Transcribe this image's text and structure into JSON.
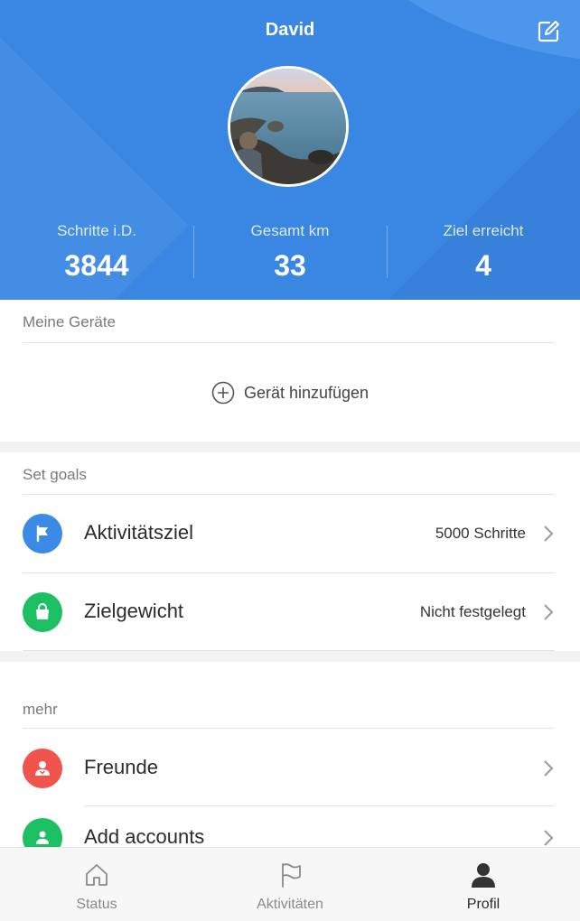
{
  "header": {
    "user_name": "David",
    "stats": [
      {
        "label": "Schritte i.D.",
        "value": "3844"
      },
      {
        "label": "Gesamt km",
        "value": "33"
      },
      {
        "label": "Ziel erreicht",
        "value": "4"
      }
    ],
    "accent": "#3a87e3"
  },
  "devices": {
    "title": "Meine Geräte",
    "add_label": "Gerät hinzufügen"
  },
  "goals": {
    "title": "Set goals",
    "items": [
      {
        "label": "Aktivitätsziel",
        "value": "5000 Schritte",
        "icon": "flag-icon",
        "color": "#3b8ae6"
      },
      {
        "label": "Zielgewicht",
        "value": "Nicht festgelegt",
        "icon": "bag-icon",
        "color": "#1dbf63"
      }
    ]
  },
  "more": {
    "title": "mehr",
    "items": [
      {
        "label": "Freunde",
        "icon": "friend-icon",
        "color": "#f0544c"
      },
      {
        "label": "Add accounts",
        "icon": "accounts-icon",
        "color": "#1dbf63"
      }
    ]
  },
  "nav": {
    "items": [
      {
        "label": "Status",
        "icon": "home-icon"
      },
      {
        "label": "Aktivitäten",
        "icon": "flag-outline-icon"
      },
      {
        "label": "Profil",
        "icon": "person-icon"
      }
    ],
    "active": "Profil"
  }
}
